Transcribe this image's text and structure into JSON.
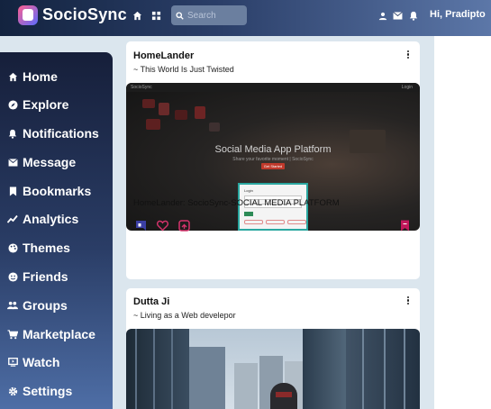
{
  "header": {
    "brand": "SocioSync",
    "search_placeholder": "Search",
    "greeting": "Hi, Pradipto"
  },
  "sidebar": {
    "items": [
      {
        "label": "Home",
        "icon": "home-icon"
      },
      {
        "label": "Explore",
        "icon": "compass-icon"
      },
      {
        "label": "Notifications",
        "icon": "bell-icon"
      },
      {
        "label": "Message",
        "icon": "mail-icon"
      },
      {
        "label": "Bookmarks",
        "icon": "bookmark-icon"
      },
      {
        "label": "Analytics",
        "icon": "trend-icon"
      },
      {
        "label": "Themes",
        "icon": "palette-icon"
      },
      {
        "label": "Friends",
        "icon": "smile-icon"
      },
      {
        "label": "Groups",
        "icon": "group-icon"
      },
      {
        "label": "Marketplace",
        "icon": "cart-icon"
      },
      {
        "label": "Watch",
        "icon": "tv-icon"
      },
      {
        "label": "Settings",
        "icon": "gear-icon"
      }
    ]
  },
  "posts": [
    {
      "author": "HomeLander",
      "subtitle": "~ This World Is Just Twisted",
      "caption": "HomeLander: SocioSync-SOCIAL MEDIA PLATFORM",
      "media": {
        "brand": "SocioSync",
        "nav_link": "Login",
        "title": "Social Media App Platform",
        "subtitle": "Share your favorite moment | SocioSync",
        "cta": "Get Started",
        "card_title": "Login"
      }
    },
    {
      "author": "Dutta Ji",
      "subtitle": "~ Living as a Web develepor"
    }
  ]
}
